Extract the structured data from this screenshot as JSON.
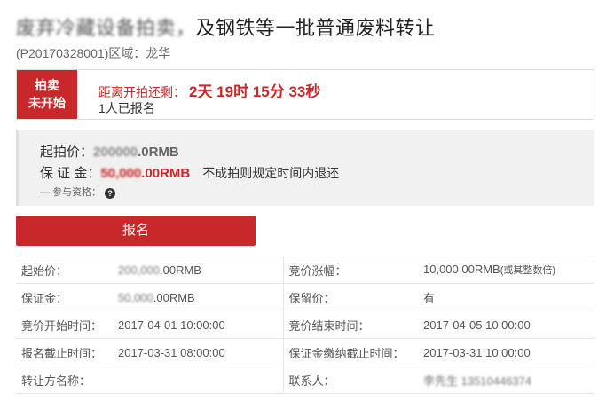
{
  "header": {
    "title_blurred": "废弃冷藏设备拍卖，",
    "title_visible": "及钢铁等一批普通废料转让",
    "code_region": "(P20170328001)区域：龙华"
  },
  "status": {
    "badge_line1": "拍卖",
    "badge_line2": "未开始",
    "countdown_label": "距离开拍还剩：",
    "countdown_time": "2天 19时 15分 33秒",
    "signup_count": "1人已报名"
  },
  "price_panel": {
    "start_label": "起拍价：",
    "start_blurred": "200000",
    "start_unit": ".0RMB",
    "deposit_label": "保 证 金：",
    "deposit_blurred": "50,000",
    "deposit_unit": ".00RMB",
    "deposit_note": "不成拍则规定时间内退还",
    "eligibility": "— 参与资格：",
    "help_icon_char": "?"
  },
  "signup_button": "报名",
  "info_rows": [
    {
      "l1": "起始价：",
      "v1_blur": "200,000",
      "v1": ".00RMB",
      "l2": "竞价涨幅：",
      "v2": "10,000.00RMB",
      "v2_small": "(或其整数倍)"
    },
    {
      "l1": "保证金：",
      "v1_blur": "50,000",
      "v1": ".00RMB",
      "l2": "保留价：",
      "v2": "有",
      "v2_small": ""
    },
    {
      "l1": "竞价开始时间：",
      "v1_blur": "",
      "v1": "2017-04-01 10:00:00",
      "l2": "竞价结束时间：",
      "v2": "2017-04-05 10:00:00",
      "v2_small": ""
    },
    {
      "l1": "报名截止时间：",
      "v1_blur": "",
      "v1": "2017-03-31 08:00:00",
      "l2": "保证金缴纳截止时间：",
      "v2": "2017-03-31 10:00:00",
      "v2_small": ""
    },
    {
      "l1": "转让方名称：",
      "v1_blur": "",
      "v1": "",
      "l2": "联系人：",
      "v2_blur": "李先生 13510446374",
      "v2": "",
      "v2_small": ""
    }
  ],
  "colors": {
    "accent": "#c8282a",
    "panel_bg": "#f1f1f1",
    "border": "#e6e6e6"
  }
}
